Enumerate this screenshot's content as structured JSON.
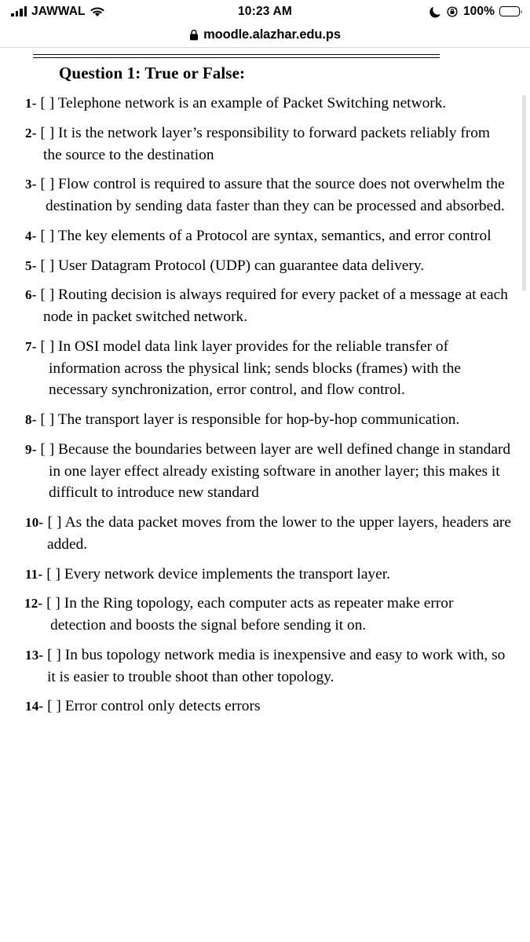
{
  "status_bar": {
    "carrier": "JAWWAL",
    "signal_icon": "signal-bars-icon",
    "wifi_icon": "wifi-icon",
    "time": "10:23 AM",
    "do_not_disturb_icon": "moon-icon",
    "rotation_lock_icon": "rotation-lock-icon",
    "battery_percent": "100%",
    "battery_icon": "battery-icon"
  },
  "browser": {
    "lock_icon": "lock-icon",
    "url": "moodle.alazhar.edu.ps"
  },
  "document": {
    "title_prefix": "Question 1",
    "title_suffix": ": True or False:",
    "title_full": "Question 1: True or False:",
    "items": [
      {
        "number": "1-",
        "bracket": "[      ]",
        "text": "Telephone network is an example of Packet Switching network."
      },
      {
        "number": "2-",
        "bracket": "[      ]",
        "text": "It is the network layer’s responsibility to forward packets reliably from the source to the destination"
      },
      {
        "number": "3-",
        "bracket": "[      ]",
        "text": "Flow control is required to assure that the source does not overwhelm the destination by sending data faster than they can be processed and absorbed."
      },
      {
        "number": "4-",
        "bracket": "[      ]",
        "text": "The key elements of a Protocol are syntax, semantics, and error control"
      },
      {
        "number": "5-",
        "bracket": "[      ]",
        "text": "User Datagram Protocol (UDP) can guarantee data delivery."
      },
      {
        "number": "6-",
        "bracket": "[      ]",
        "text": "Routing decision is always required for every packet of a message at each node in packet switched network."
      },
      {
        "number": "7-",
        "bracket": "[      ]",
        "text": "In OSI model data link layer provides for the reliable transfer of information across the physical link; sends blocks (frames) with the necessary synchronization, error control, and flow control."
      },
      {
        "number": "8-",
        "bracket": "[      ]",
        "text": "The transport layer is responsible for hop-by-hop communication."
      },
      {
        "number": "9-",
        "bracket": "[      ]",
        "text": "Because the boundaries between layer are well defined change in standard in one layer effect  already existing software in another layer; this makes it difficult to introduce new standard"
      },
      {
        "number": "10-",
        "bracket": "[      ]",
        "text": "As the data packet moves from the lower to the upper  layers, headers are added."
      },
      {
        "number": "11-",
        "bracket": "[      ]",
        "text": "Every network device implements the transport layer."
      },
      {
        "number": "12-",
        "bracket": "[      ]",
        "text": "In the Ring topology, each computer acts as repeater make error detection and boosts the signal before sending it on."
      },
      {
        "number": "13-",
        "bracket": "[      ]",
        "text": "In bus topology network media is inexpensive and easy to work with, so it is easier to trouble shoot than other topology."
      },
      {
        "number": "14-",
        "bracket": "[      ]",
        "text": "Error control only detects errors"
      }
    ]
  },
  "colors": {
    "background": "#ffffff",
    "text": "#000000",
    "rule": "#0b0b0b",
    "scrollbar": "#e2e2e2",
    "chrome_divider": "#d6d6d6"
  }
}
